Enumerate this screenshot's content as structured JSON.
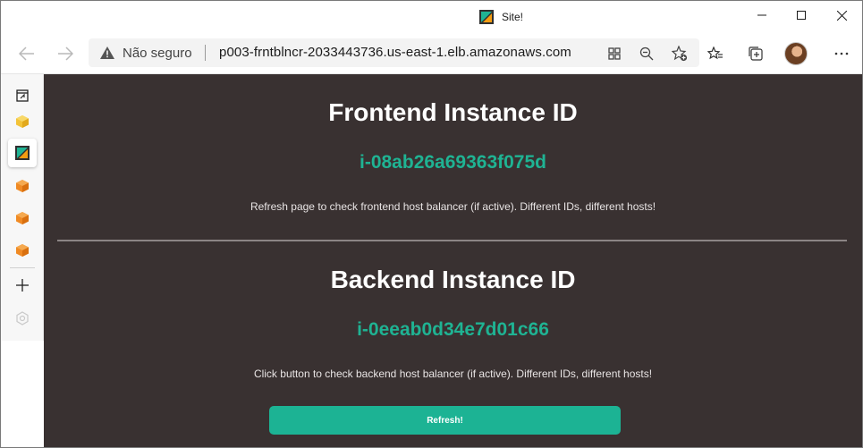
{
  "window": {
    "title": "Site!",
    "controls": {
      "minimize": "minimize",
      "maximize": "maximize",
      "close": "close"
    }
  },
  "toolbar": {
    "not_secure_label": "Não seguro",
    "url": "p003-frntblncr-2033443736.us-east-1.elb.amazonaws.com"
  },
  "sidebar": {
    "items": [
      "tab-panel-icon",
      "package-icon",
      "site-favicon",
      "package-icon",
      "package-icon",
      "package-icon",
      "add-icon",
      "extension-icon"
    ]
  },
  "page": {
    "frontend": {
      "title": "Frontend Instance ID",
      "instance_id": "i-08ab26a69363f075d",
      "note": "Refresh page to check frontend host balancer (if active). Different IDs, different hosts!"
    },
    "backend": {
      "title": "Backend Instance ID",
      "instance_id": "i-0eeab0d34e7d01c66",
      "note": "Click button to check backend host balancer (if active). Different IDs, different hosts!"
    },
    "refresh_button": "Refresh!"
  },
  "colors": {
    "page_bg": "#393131",
    "accent": "#1cb394",
    "id_text": "#1fb393"
  }
}
